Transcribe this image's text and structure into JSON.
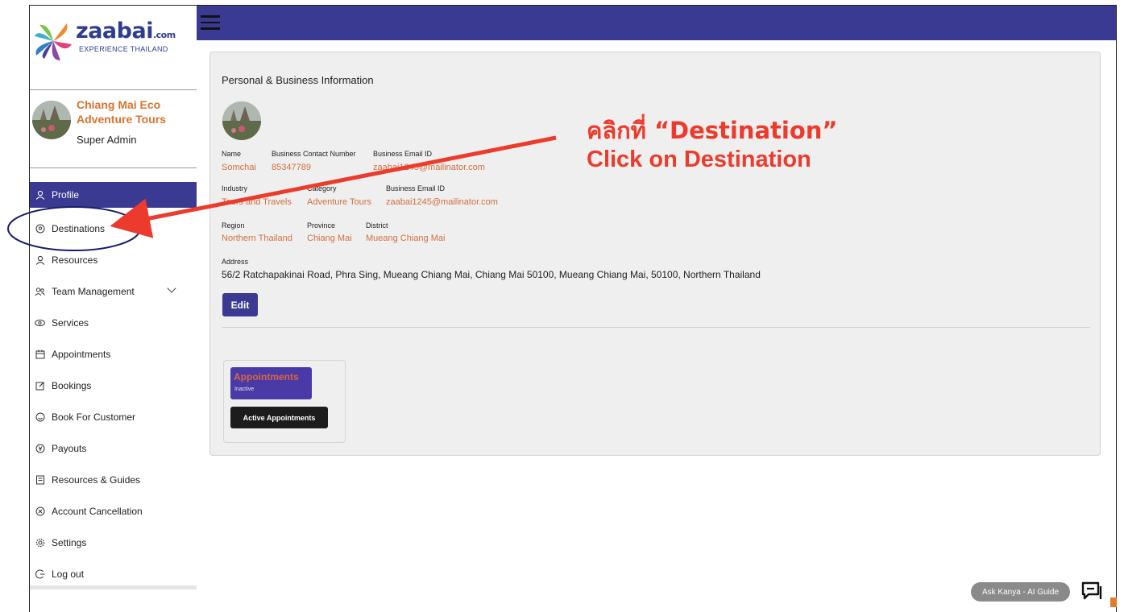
{
  "brand": {
    "logo_text": "zaabai",
    "logo_suffix": ".com",
    "tagline": "EXPERIENCE THAILAND"
  },
  "business": {
    "name_line1": "Chiang Mai Eco",
    "name_line2": "Adventure Tours",
    "role": "Super Admin"
  },
  "nav": {
    "profile": "Profile",
    "destinations": "Destinations",
    "resources": "Resources",
    "team_management": "Team Management",
    "services": "Services",
    "appointments": "Appointments",
    "bookings": "Bookings",
    "book_for_customer": "Book For Customer",
    "payouts": "Payouts",
    "resources_guides": "Resources & Guides",
    "account_cancellation": "Account Cancellation",
    "settings": "Settings",
    "log_out": "Log out"
  },
  "main": {
    "title": "Personal & Business Information",
    "fields": {
      "name_label": "Name",
      "name_value": "Somchai",
      "contact_label": "Business Contact Number",
      "contact_value": "85347789",
      "email_label": "Business Email ID",
      "email_value": "zaabai1245@mailinator.com",
      "industry_label": "Industry",
      "industry_value": "Tours and Travels",
      "category_label": "Category",
      "category_value": "Adventure Tours",
      "email2_label": "Business Email ID",
      "email2_value": "zaabai1245@mailinator.com",
      "region_label": "Region",
      "region_value": "Northern Thailand",
      "province_label": "Province",
      "province_value": "Chiang Mai",
      "district_label": "District",
      "district_value": "Mueang Chiang Mai",
      "address_label": "Address",
      "address_value": "56/2 Ratchapakinai Road, Phra Sing, Mueang Chiang Mai, Chiang Mai 50100, Mueang Chiang Mai, 50100, Northern Thailand"
    },
    "edit_label": "Edit",
    "appointments_card": {
      "title": "Appointments",
      "status": "Inactive",
      "button": "Active Appointments"
    }
  },
  "annotation": {
    "line1": "คลิกที่ “Destination”",
    "line2": "Click on Destination",
    "color": "#ec3b2c"
  },
  "assistant": {
    "label": "Ask Kanya - AI Guide"
  },
  "colors": {
    "primary": "#3b3a92",
    "accent": "#d9732e"
  }
}
